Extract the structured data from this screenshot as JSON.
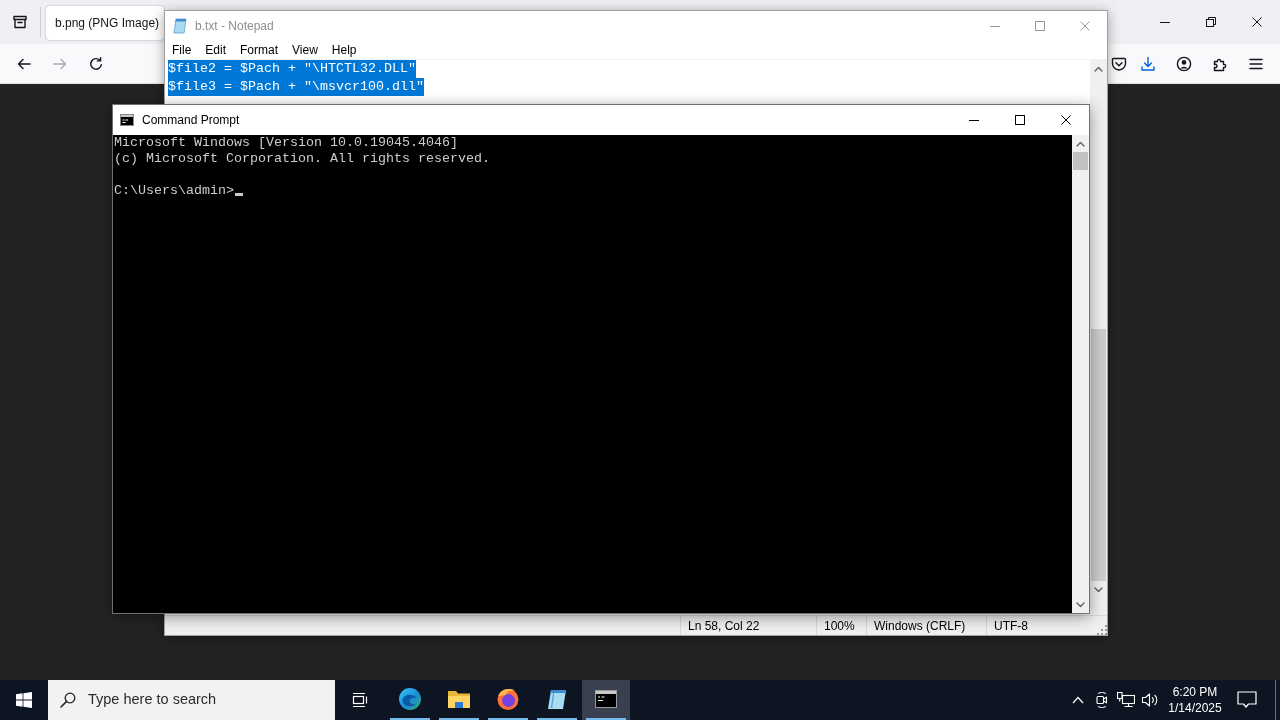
{
  "browser": {
    "tab": {
      "title": "b.png (PNG Image)",
      "selected": true
    },
    "nav_buttons": [
      {
        "kind": "back",
        "disabled": false
      },
      {
        "kind": "forward",
        "disabled": true
      },
      {
        "kind": "reload",
        "disabled": false
      }
    ],
    "toolbar_buttons": [
      {
        "kind": "pocket",
        "active": false
      },
      {
        "kind": "downloads",
        "active": true
      },
      {
        "kind": "account",
        "active": false
      },
      {
        "kind": "extensions",
        "active": false
      },
      {
        "kind": "menu",
        "active": false
      }
    ]
  },
  "notepad": {
    "title": "b.txt - Notepad",
    "active": false,
    "menu": [
      "File",
      "Edit",
      "Format",
      "View",
      "Help"
    ],
    "lines": [
      {
        "text": "$file2 = $Pach + \"\\HTCTL32.DLL\"",
        "selected": true
      },
      {
        "text": "$file3 = $Pach + \"\\msvcr100.dll\"",
        "selected": true
      }
    ],
    "status_bar": [
      "Ln 58, Col 22",
      "100%",
      "Windows (CRLF)",
      "UTF-8"
    ]
  },
  "command_prompt": {
    "title": "Command Prompt",
    "active": true,
    "output": [
      "Microsoft Windows [Version 10.0.19045.4046]",
      "(c) Microsoft Corporation. All rights reserved."
    ],
    "prompt": "C:\\Users\\admin>"
  },
  "taskbar": {
    "search": {
      "placeholder": "Type here to search"
    },
    "apps": [
      {
        "kind": "edge",
        "running": true,
        "selected": false
      },
      {
        "kind": "explorer",
        "running": true,
        "selected": false
      },
      {
        "kind": "firefox",
        "running": true,
        "selected": false
      },
      {
        "kind": "notepad",
        "running": true,
        "selected": false
      },
      {
        "kind": "terminal",
        "running": true,
        "selected": true
      }
    ],
    "tray": [
      {
        "kind": "chevron"
      },
      {
        "kind": "meet"
      },
      {
        "kind": "network"
      },
      {
        "kind": "volume"
      }
    ],
    "clock": {
      "time": "6:20 PM",
      "date": "1/14/2025"
    }
  }
}
